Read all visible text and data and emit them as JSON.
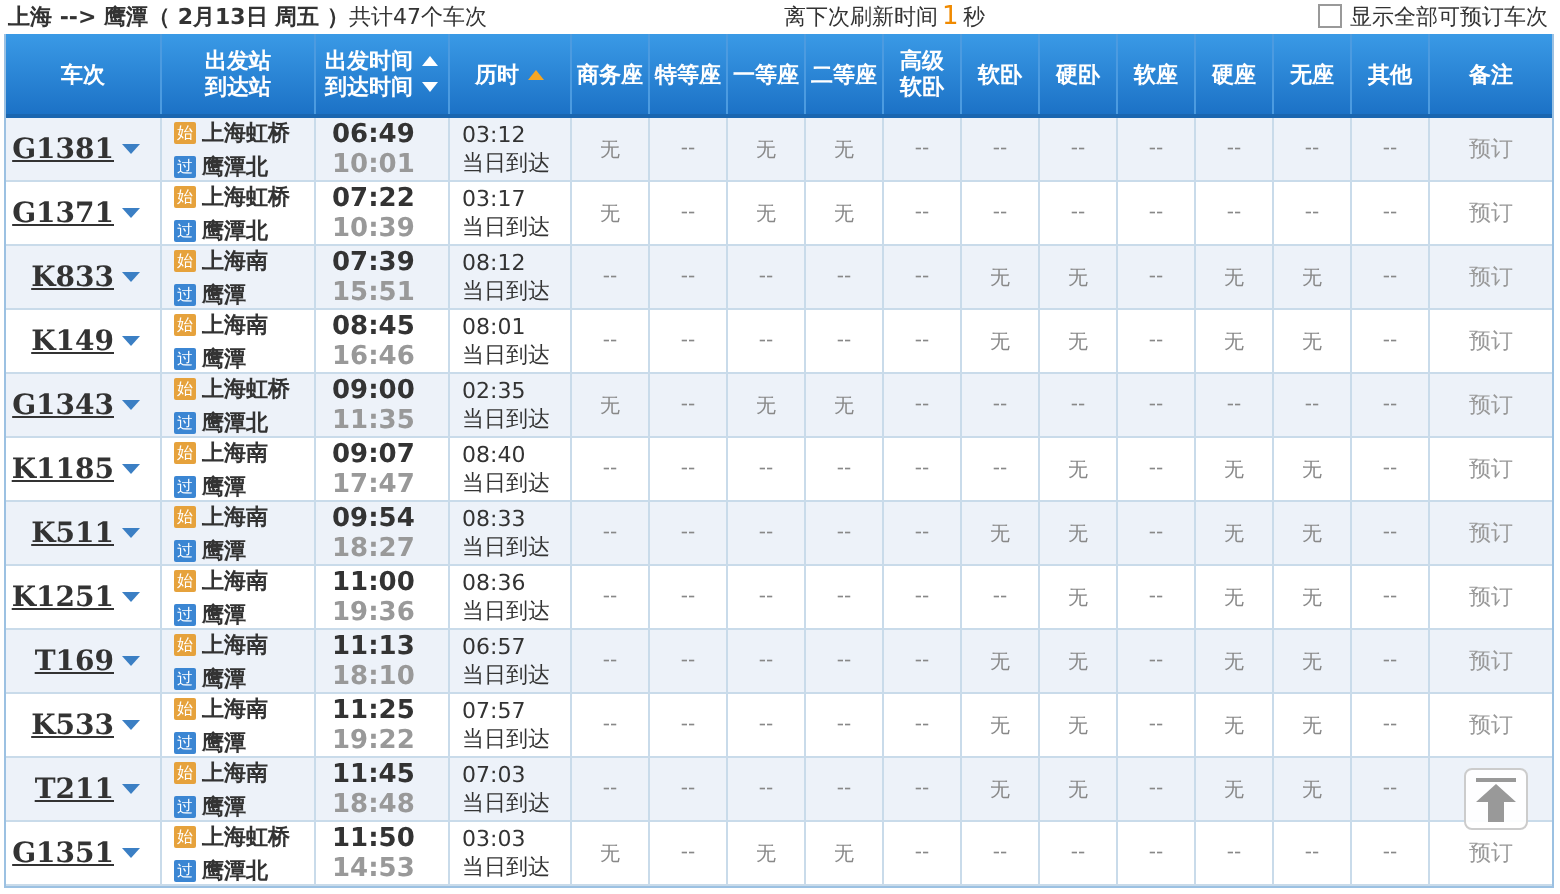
{
  "top_bar": {
    "summary": "**上海 --> 鹰潭（ 2月13日  周五 ）**共计47个车次",
    "refresh_label": "离下次刷新时间",
    "refresh_value": "1",
    "refresh_unit": "秒",
    "show_all": {
      "label": "显示全部可预订车次",
      "checked": false
    }
  },
  "columns": [
    {
      "lines": [
        {
          "text": "车次"
        }
      ]
    },
    {
      "lines": [
        {
          "text": "出发站"
        },
        {
          "text": "到达站"
        }
      ]
    },
    {
      "lines": [
        {
          "text": "出发时间",
          "kind": "sort-up"
        },
        {
          "text": "到达时间",
          "kind": "sort-down"
        }
      ]
    },
    {
      "lines": [
        {
          "text": "历时",
          "kind": "sort-active"
        }
      ]
    },
    {
      "lines": [
        {
          "text": "商务座"
        }
      ]
    },
    {
      "lines": [
        {
          "text": "特等座"
        }
      ]
    },
    {
      "lines": [
        {
          "text": "一等座"
        }
      ]
    },
    {
      "lines": [
        {
          "text": "二等座"
        }
      ]
    },
    {
      "lines": [
        {
          "text": "高级"
        },
        {
          "text": "软卧"
        }
      ]
    },
    {
      "lines": [
        {
          "text": "软卧"
        }
      ]
    },
    {
      "lines": [
        {
          "text": "硬卧"
        }
      ]
    },
    {
      "lines": [
        {
          "text": "软座"
        }
      ]
    },
    {
      "lines": [
        {
          "text": "硬座"
        }
      ]
    },
    {
      "lines": [
        {
          "text": "无座"
        }
      ]
    },
    {
      "lines": [
        {
          "text": "其他"
        }
      ]
    },
    {
      "lines": [
        {
          "text": "备注"
        }
      ]
    }
  ],
  "rows": [
    {
      "train": "G1381",
      "from": {
        "badge": "始",
        "name": "上海虹桥"
      },
      "to": {
        "badge": "过",
        "name": "鹰潭北"
      },
      "depart": "06:49",
      "arrive": "10:01",
      "duration": "03:12",
      "arrival_day": "当日到达",
      "seats": [
        "无",
        "--",
        "无",
        "无",
        "--",
        "--",
        "--",
        "--",
        "--",
        "--",
        "--"
      ],
      "remark": "预订"
    },
    {
      "train": "G1371",
      "from": {
        "badge": "始",
        "name": "上海虹桥"
      },
      "to": {
        "badge": "过",
        "name": "鹰潭北"
      },
      "depart": "07:22",
      "arrive": "10:39",
      "duration": "03:17",
      "arrival_day": "当日到达",
      "seats": [
        "无",
        "--",
        "无",
        "无",
        "--",
        "--",
        "--",
        "--",
        "--",
        "--",
        "--"
      ],
      "remark": "预订"
    },
    {
      "train": "K833",
      "from": {
        "badge": "始",
        "name": "上海南"
      },
      "to": {
        "badge": "过",
        "name": "鹰潭"
      },
      "depart": "07:39",
      "arrive": "15:51",
      "duration": "08:12",
      "arrival_day": "当日到达",
      "seats": [
        "--",
        "--",
        "--",
        "--",
        "--",
        "无",
        "无",
        "--",
        "无",
        "无",
        "--"
      ],
      "remark": "预订"
    },
    {
      "train": "K149",
      "from": {
        "badge": "始",
        "name": "上海南"
      },
      "to": {
        "badge": "过",
        "name": "鹰潭"
      },
      "depart": "08:45",
      "arrive": "16:46",
      "duration": "08:01",
      "arrival_day": "当日到达",
      "seats": [
        "--",
        "--",
        "--",
        "--",
        "--",
        "无",
        "无",
        "--",
        "无",
        "无",
        "--"
      ],
      "remark": "预订"
    },
    {
      "train": "G1343",
      "from": {
        "badge": "始",
        "name": "上海虹桥"
      },
      "to": {
        "badge": "过",
        "name": "鹰潭北"
      },
      "depart": "09:00",
      "arrive": "11:35",
      "duration": "02:35",
      "arrival_day": "当日到达",
      "seats": [
        "无",
        "--",
        "无",
        "无",
        "--",
        "--",
        "--",
        "--",
        "--",
        "--",
        "--"
      ],
      "remark": "预订"
    },
    {
      "train": "K1185",
      "from": {
        "badge": "始",
        "name": "上海南"
      },
      "to": {
        "badge": "过",
        "name": "鹰潭"
      },
      "depart": "09:07",
      "arrive": "17:47",
      "duration": "08:40",
      "arrival_day": "当日到达",
      "seats": [
        "--",
        "--",
        "--",
        "--",
        "--",
        "--",
        "无",
        "--",
        "无",
        "无",
        "--"
      ],
      "remark": "预订"
    },
    {
      "train": "K511",
      "from": {
        "badge": "始",
        "name": "上海南"
      },
      "to": {
        "badge": "过",
        "name": "鹰潭"
      },
      "depart": "09:54",
      "arrive": "18:27",
      "duration": "08:33",
      "arrival_day": "当日到达",
      "seats": [
        "--",
        "--",
        "--",
        "--",
        "--",
        "无",
        "无",
        "--",
        "无",
        "无",
        "--"
      ],
      "remark": "预订"
    },
    {
      "train": "K1251",
      "from": {
        "badge": "始",
        "name": "上海南"
      },
      "to": {
        "badge": "过",
        "name": "鹰潭"
      },
      "depart": "11:00",
      "arrive": "19:36",
      "duration": "08:36",
      "arrival_day": "当日到达",
      "seats": [
        "--",
        "--",
        "--",
        "--",
        "--",
        "--",
        "无",
        "--",
        "无",
        "无",
        "--"
      ],
      "remark": "预订"
    },
    {
      "train": "T169",
      "from": {
        "badge": "始",
        "name": "上海南"
      },
      "to": {
        "badge": "过",
        "name": "鹰潭"
      },
      "depart": "11:13",
      "arrive": "18:10",
      "duration": "06:57",
      "arrival_day": "当日到达",
      "seats": [
        "--",
        "--",
        "--",
        "--",
        "--",
        "无",
        "无",
        "--",
        "无",
        "无",
        "--"
      ],
      "remark": "预订"
    },
    {
      "train": "K533",
      "from": {
        "badge": "始",
        "name": "上海南"
      },
      "to": {
        "badge": "过",
        "name": "鹰潭"
      },
      "depart": "11:25",
      "arrive": "19:22",
      "duration": "07:57",
      "arrival_day": "当日到达",
      "seats": [
        "--",
        "--",
        "--",
        "--",
        "--",
        "无",
        "无",
        "--",
        "无",
        "无",
        "--"
      ],
      "remark": "预订"
    },
    {
      "train": "T211",
      "from": {
        "badge": "始",
        "name": "上海南"
      },
      "to": {
        "badge": "过",
        "name": "鹰潭"
      },
      "depart": "11:45",
      "arrive": "18:48",
      "duration": "07:03",
      "arrival_day": "当日到达",
      "seats": [
        "--",
        "--",
        "--",
        "--",
        "--",
        "无",
        "无",
        "--",
        "无",
        "无",
        "--"
      ]
    },
    {
      "train": "G1351",
      "from": {
        "badge": "始",
        "name": "上海虹桥"
      },
      "to": {
        "badge": "过",
        "name": "鹰潭北"
      },
      "depart": "11:50",
      "arrive": "14:53",
      "duration": "03:03",
      "arrival_day": "当日到达",
      "seats": [
        "无",
        "--",
        "无",
        "无",
        "--",
        "--",
        "--",
        "--",
        "--",
        "--",
        "--"
      ],
      "remark": "预订"
    }
  ]
}
